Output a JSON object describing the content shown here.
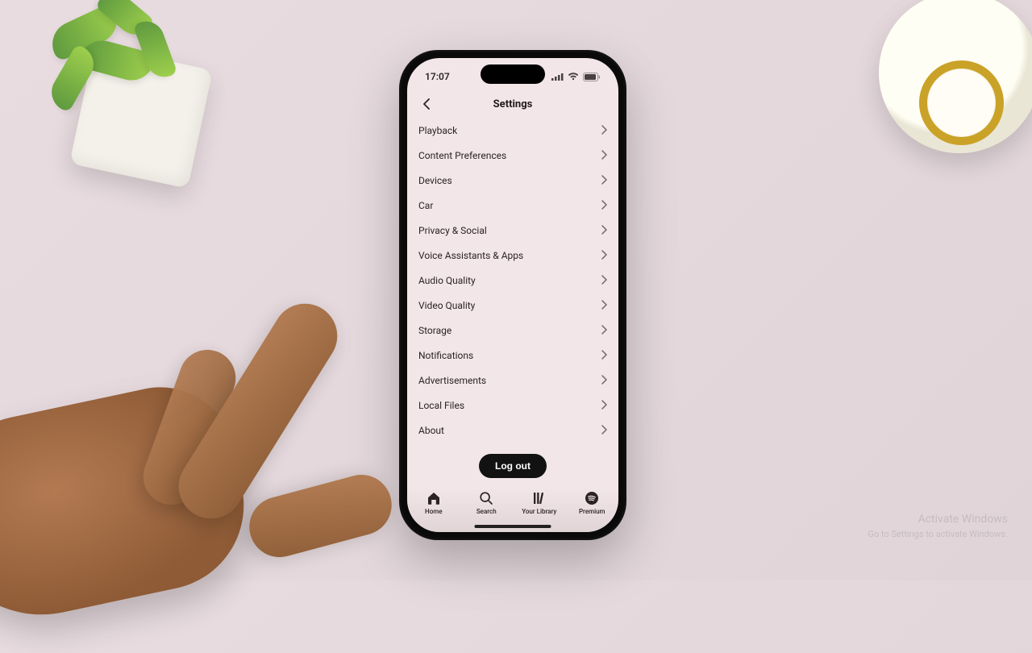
{
  "statusbar": {
    "time": "17:07"
  },
  "header": {
    "title": "Settings"
  },
  "settings": [
    {
      "label": "Playback"
    },
    {
      "label": "Content Preferences"
    },
    {
      "label": "Devices"
    },
    {
      "label": "Car"
    },
    {
      "label": "Privacy & Social"
    },
    {
      "label": "Voice Assistants & Apps"
    },
    {
      "label": "Audio Quality"
    },
    {
      "label": "Video Quality"
    },
    {
      "label": "Storage"
    },
    {
      "label": "Notifications"
    },
    {
      "label": "Advertisements"
    },
    {
      "label": "Local Files"
    },
    {
      "label": "About"
    }
  ],
  "logout_label": "Log out",
  "tabs": [
    {
      "label": "Home"
    },
    {
      "label": "Search"
    },
    {
      "label": "Your Library"
    },
    {
      "label": "Premium"
    }
  ],
  "watermark": {
    "line1": "Activate Windows",
    "line2": "Go to Settings to activate Windows."
  }
}
